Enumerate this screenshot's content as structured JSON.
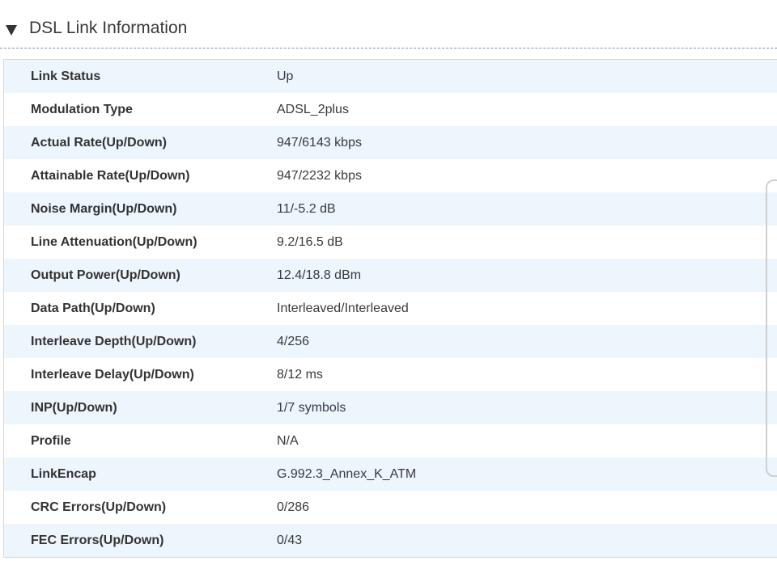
{
  "section": {
    "title": "DSL Link Information",
    "collapse_icon": "triangle-down-icon"
  },
  "rows": [
    {
      "label": "Link Status",
      "value": "Up"
    },
    {
      "label": "Modulation Type",
      "value": "ADSL_2plus"
    },
    {
      "label": "Actual Rate(Up/Down)",
      "value": "947/6143 kbps"
    },
    {
      "label": "Attainable Rate(Up/Down)",
      "value": "947/2232 kbps"
    },
    {
      "label": "Noise Margin(Up/Down)",
      "value": "11/-5.2 dB"
    },
    {
      "label": "Line Attenuation(Up/Down)",
      "value": "9.2/16.5 dB"
    },
    {
      "label": "Output Power(Up/Down)",
      "value": "12.4/18.8 dBm"
    },
    {
      "label": "Data Path(Up/Down)",
      "value": "Interleaved/Interleaved"
    },
    {
      "label": "Interleave Depth(Up/Down)",
      "value": "4/256"
    },
    {
      "label": "Interleave Delay(Up/Down)",
      "value": "8/12 ms"
    },
    {
      "label": "INP(Up/Down)",
      "value": "1/7 symbols"
    },
    {
      "label": "Profile",
      "value": "N/A"
    },
    {
      "label": "LinkEncap",
      "value": "G.992.3_Annex_K_ATM"
    },
    {
      "label": "CRC Errors(Up/Down)",
      "value": "0/286"
    },
    {
      "label": "FEC Errors(Up/Down)",
      "value": "0/43"
    }
  ],
  "colors": {
    "row_alt_bg": "#edf5fd",
    "row_bg": "#ffffff",
    "text": "#333333"
  }
}
